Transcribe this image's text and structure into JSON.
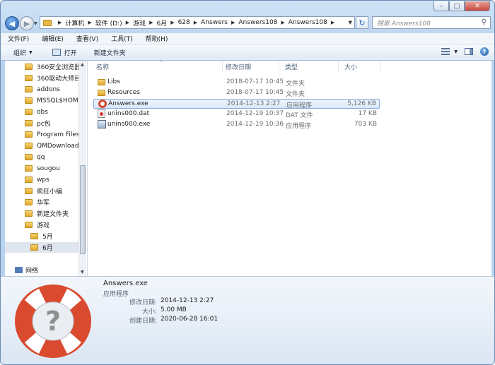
{
  "address_bar": {
    "crumbs": [
      "计算机",
      "软件 (D:)",
      "游戏",
      "6月",
      "628",
      "Answers",
      "Answers108",
      "Answers108"
    ],
    "search_placeholder": "搜索 Answers108"
  },
  "menu": [
    "文件(F)",
    "编辑(E)",
    "查看(V)",
    "工具(T)",
    "帮助(H)"
  ],
  "toolbar": {
    "organize": "组织",
    "open": "打开",
    "new_folder": "新建文件夹"
  },
  "nav_tree": [
    {
      "label": "360安全浏览器下",
      "indent": 0
    },
    {
      "label": "360驱动大师目录",
      "indent": 0
    },
    {
      "label": "addons",
      "indent": 0
    },
    {
      "label": "MSSQL$HOME",
      "indent": 0
    },
    {
      "label": "obs",
      "indent": 0
    },
    {
      "label": "pc包",
      "indent": 0
    },
    {
      "label": "Program Files (",
      "indent": 0
    },
    {
      "label": "QMDownload",
      "indent": 0
    },
    {
      "label": "qq",
      "indent": 0
    },
    {
      "label": "sougou",
      "indent": 0
    },
    {
      "label": "wps",
      "indent": 0
    },
    {
      "label": "疯狂小编",
      "indent": 0
    },
    {
      "label": "华军",
      "indent": 0
    },
    {
      "label": "新建文件夹",
      "indent": 0
    },
    {
      "label": "游戏",
      "indent": 0
    },
    {
      "label": "5月",
      "indent": 1
    },
    {
      "label": "6月",
      "indent": 1
    }
  ],
  "nav_network": "网络",
  "columns": {
    "name": "名称",
    "modified": "修改日期",
    "type": "类型",
    "size": "大小"
  },
  "files": [
    {
      "name": "Libs",
      "modified": "2018-07-17 10:45",
      "type": "文件夹",
      "size": "",
      "icon": "folder-icon",
      "selected": false
    },
    {
      "name": "Resources",
      "modified": "2018-07-17 10:45",
      "type": "文件夹",
      "size": "",
      "icon": "folder-icon",
      "selected": false
    },
    {
      "name": "Answers.exe",
      "modified": "2014-12-13 2:27",
      "type": "应用程序",
      "size": "5,126 KB",
      "icon": "lifebuoy-icon",
      "selected": true
    },
    {
      "name": "unins000.dat",
      "modified": "2014-12-19 10:37",
      "type": "DAT 文件",
      "size": "17 KB",
      "icon": "dat-file-icon",
      "selected": false
    },
    {
      "name": "unins000.exe",
      "modified": "2014-12-19 10:36",
      "type": "应用程序",
      "size": "703 KB",
      "icon": "exe-file-icon",
      "selected": false
    }
  ],
  "details": {
    "name": "Answers.exe",
    "type": "应用程序",
    "modified_label": "修改日期:",
    "modified_value": "2014-12-13 2:27",
    "size_label": "大小:",
    "size_value": "5.00 MB",
    "created_label": "创建日期:",
    "created_value": "2020-06-28 16:01"
  }
}
